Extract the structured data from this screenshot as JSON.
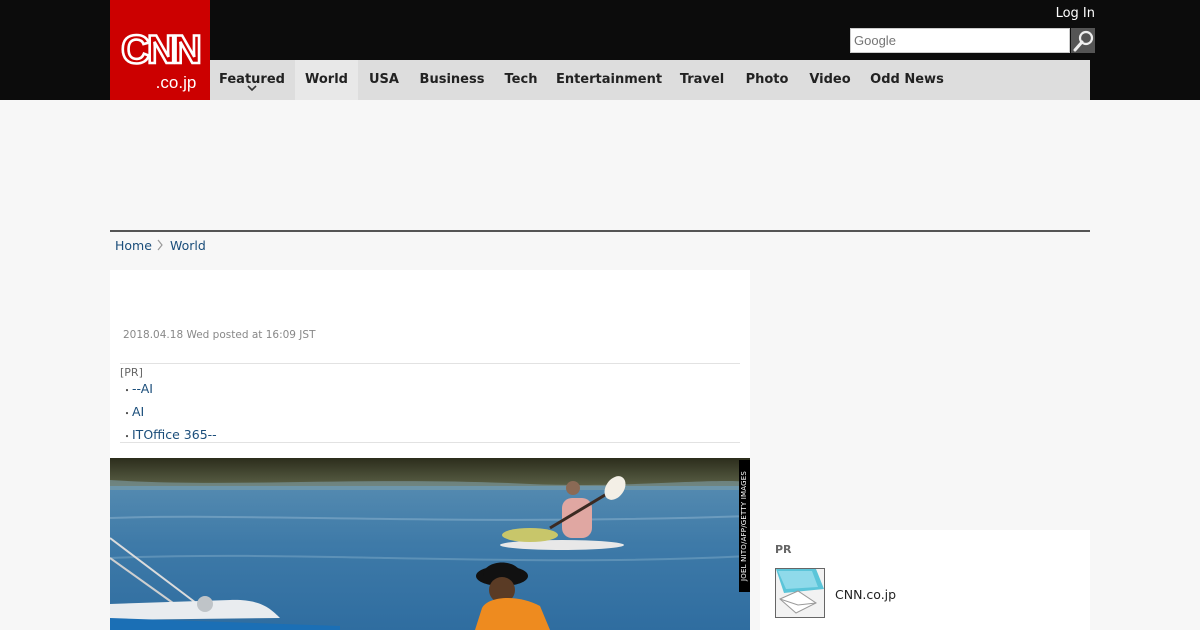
{
  "header": {
    "logo_main": "CNN",
    "logo_sub": ".co.jp",
    "login_label": "Log In",
    "search_placeholder": "Google",
    "nav": [
      {
        "label": "Featured"
      },
      {
        "label": "World"
      },
      {
        "label": "USA"
      },
      {
        "label": "Business"
      },
      {
        "label": "Tech"
      },
      {
        "label": "Entertainment"
      },
      {
        "label": "Travel"
      },
      {
        "label": "Photo"
      },
      {
        "label": "Video"
      },
      {
        "label": "Odd News"
      }
    ],
    "active_nav": "World"
  },
  "breadcrumb": {
    "home": "Home",
    "current": "World"
  },
  "article": {
    "dateline": "2018.04.18 Wed posted at 16:09 JST",
    "pr_tag": "[PR]",
    "pr_bullet": "・",
    "pr_links": [
      "--AI",
      "AI",
      "ITOffice 365--"
    ],
    "photo_credit": "JOEL NITO/AFP/GETTY IMAGES"
  },
  "sidebar": {
    "pr_title": "PR",
    "pr_link": "CNN.co.jp"
  },
  "colors": {
    "header_bg": "#0c0c0c",
    "logo_red": "#cc0000",
    "nav_bg": "#dddddd",
    "link": "#1a4d7a"
  }
}
